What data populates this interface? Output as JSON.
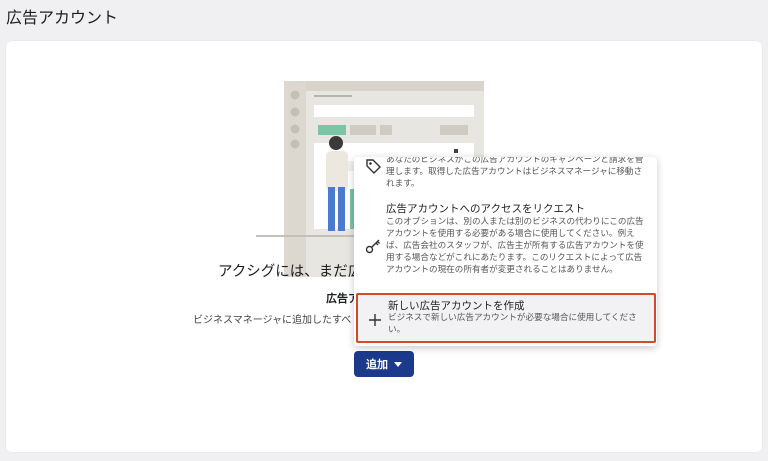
{
  "page": {
    "title": "広告アカウント"
  },
  "empty_state": {
    "title": "アクシグには、まだ広",
    "subtitle": "広告ア",
    "description": "ビジネスマネージャに追加したすべ"
  },
  "add_button": {
    "label": "追加"
  },
  "menu": {
    "items": [
      {
        "icon": "tag-icon",
        "title": "",
        "description": "あなたのビジネスがこの広告アカウントのキャンペーンと請求を管理します。取得した広告アカウントはビジネスマネージャに移動されます。"
      },
      {
        "icon": "key-icon",
        "title": "広告アカウントへのアクセスをリクエスト",
        "description": "このオプションは、別の人または別のビジネスの代わりにこの広告アカウントを使用する必要がある場合に使用してください。例えば、広告会社のスタッフが、広告主が所有する広告アカウントを使用する場合などがこれにあたります。このリクエストによって広告アカウントの現在の所有者が変更されることはありません。"
      },
      {
        "icon": "plus-icon",
        "title": "新しい広告アカウントを作成",
        "description": "ビジネスで新しい広告アカウントが必要な場合に使用してください。"
      }
    ]
  },
  "colors": {
    "primary": "#1b3a8c",
    "highlight": "#d9472b",
    "illustration_green": "#7cc4a4"
  }
}
